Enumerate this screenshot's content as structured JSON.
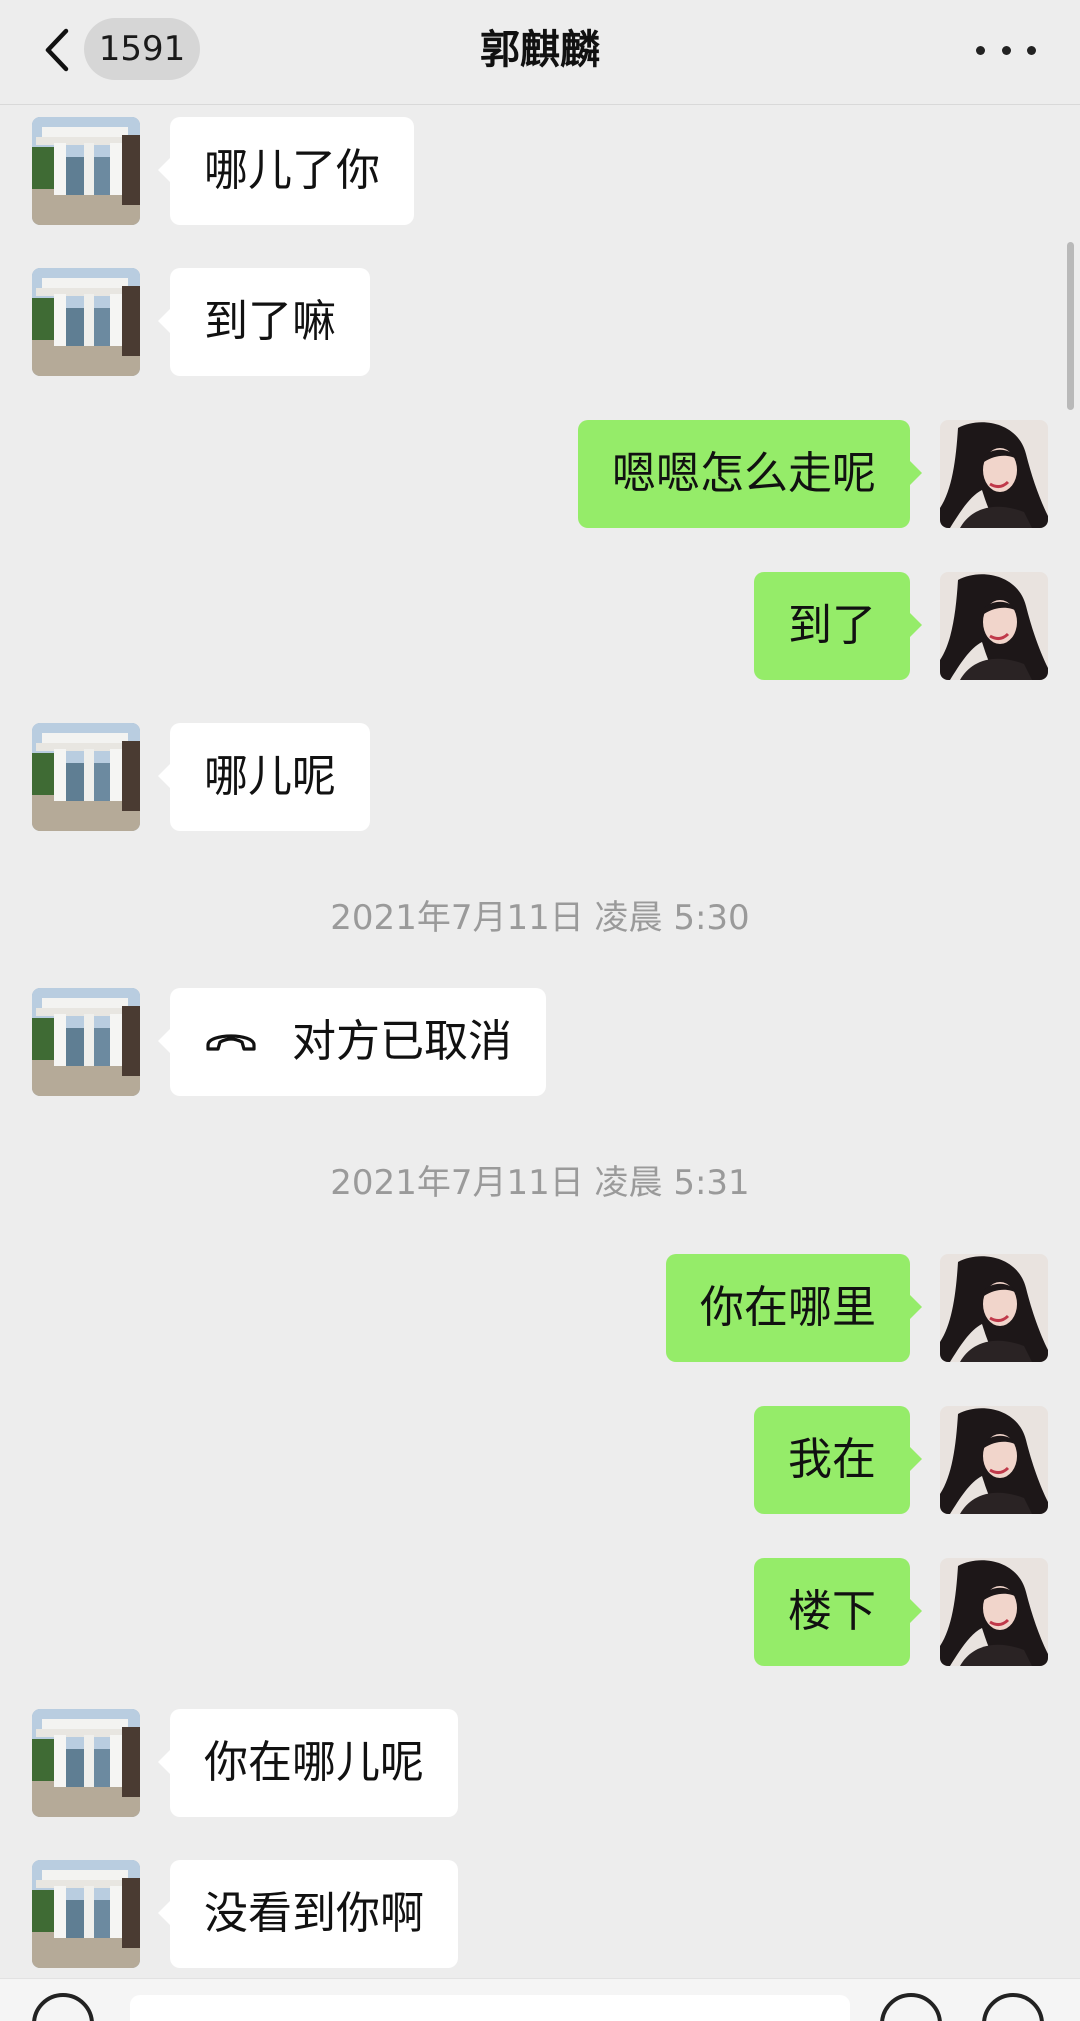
{
  "header": {
    "title": "郭麒麟",
    "unread_count": "1591"
  },
  "messages": [
    {
      "side": "left",
      "text": "哪儿了你"
    },
    {
      "side": "left",
      "text": "到了嘛"
    },
    {
      "side": "right",
      "text": "嗯嗯怎么走呢"
    },
    {
      "side": "right",
      "text": "到了"
    },
    {
      "side": "left",
      "text": "哪儿呢"
    },
    {
      "type": "timestamp",
      "text": "2021年7月11日 凌晨 5:30"
    },
    {
      "side": "left",
      "text": "对方已取消",
      "icon": "phone-hangup-icon"
    },
    {
      "type": "timestamp",
      "text": "2021年7月11日 凌晨 5:31"
    },
    {
      "side": "right",
      "text": "你在哪里"
    },
    {
      "side": "right",
      "text": "我在"
    },
    {
      "side": "right",
      "text": "楼下"
    },
    {
      "side": "left",
      "text": "你在哪儿呢"
    },
    {
      "side": "left",
      "text": "没看到你啊"
    }
  ]
}
